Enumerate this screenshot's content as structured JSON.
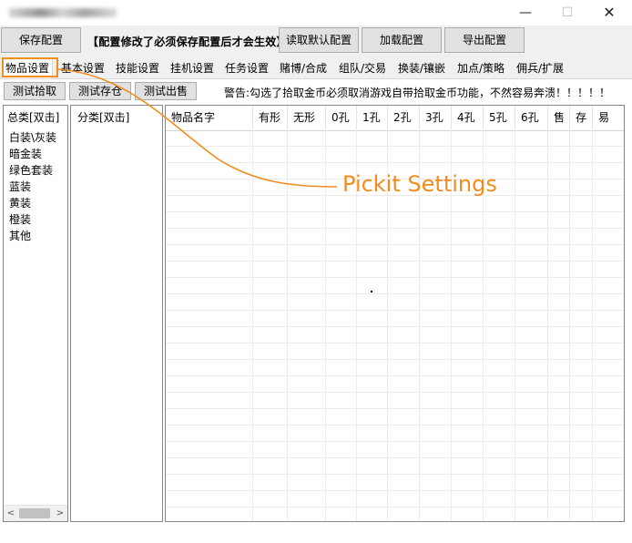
{
  "window": {
    "title": "·      ",
    "min_glyph": "—",
    "max_glyph": "☐",
    "close_glyph": "✕"
  },
  "toolbar": {
    "save_label": "保存配置",
    "notice": "【配置修改了必须保存配置后才会生效】",
    "read_default_label": "读取默认配置",
    "load_label": "加载配置",
    "export_label": "导出配置"
  },
  "tabs": [
    {
      "label": "物品设置"
    },
    {
      "label": "基本设置"
    },
    {
      "label": "技能设置"
    },
    {
      "label": "挂机设置"
    },
    {
      "label": "任务设置"
    },
    {
      "label": "赌博/合成"
    },
    {
      "label": "组队/交易"
    },
    {
      "label": "换装/镶嵌"
    },
    {
      "label": "加点/策略"
    },
    {
      "label": "佣兵/扩展"
    }
  ],
  "actions": {
    "test_pick": "测试拾取",
    "test_stash": "测试存仓",
    "test_sell": "测试出售",
    "warning": "警告:勾选了拾取金币必须取消游戏自带拾取金币功能，不然容易奔溃！！！！！"
  },
  "category_list": {
    "header": "总类[双击]",
    "items": [
      "白装\\灰装",
      "暗金装",
      "绿色套装",
      "蓝装",
      "黄装",
      "橙装",
      "其他"
    ]
  },
  "subcategory_list": {
    "header": "分类[双击]"
  },
  "item_table": {
    "columns": [
      "物品名字",
      "有形",
      "无形",
      "0孔",
      "1孔",
      "2孔",
      "3孔",
      "4孔",
      "5孔",
      "6孔",
      "售",
      "存",
      "易"
    ]
  },
  "annotation": {
    "text": "Pickit Settings",
    "color": "#f28c1e"
  },
  "scroll": {
    "left_arrow": "<",
    "right_arrow": ">"
  }
}
